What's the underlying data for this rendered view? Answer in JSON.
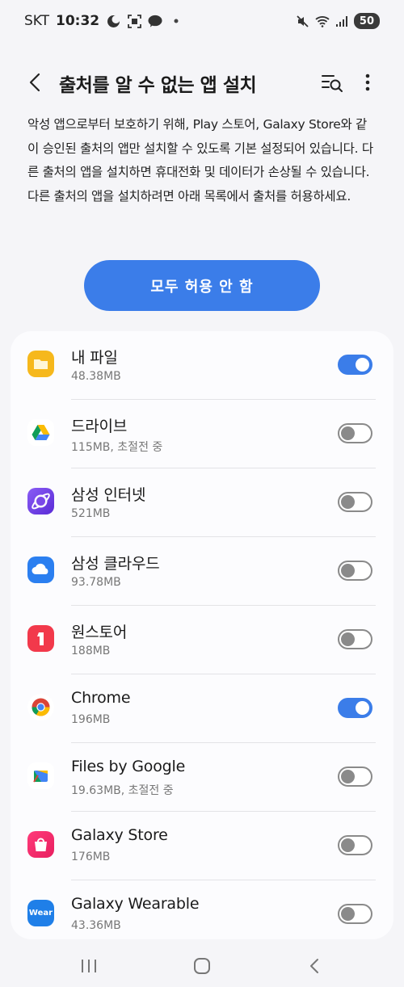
{
  "status": {
    "carrier": "SKT",
    "time": "10:32",
    "battery": "50"
  },
  "header": {
    "title": "출처를 알 수 없는 앱 설치"
  },
  "description": "악성 앱으로부터 보호하기 위해, Play 스토어, Galaxy Store와 같이 승인된 출처의 앱만 설치할 수 있도록 기본 설정되어 있습니다. 다른 출처의 앱을 설치하면 휴대전화 및 데이터가 손상될 수 있습니다. 다른 출처의 앱을 설치하려면 아래 목록에서 출처를 허용하세요.",
  "primary_button": "모두 허용 안 함",
  "colors": {
    "accent": "#3b7de9",
    "toggle_off": "#8a8a8a"
  },
  "apps": [
    {
      "name": "내 파일",
      "sub": "48.38MB",
      "enabled": true,
      "icon": "my-files-icon"
    },
    {
      "name": "드라이브",
      "sub": "115MB, 초절전 중",
      "enabled": false,
      "icon": "google-drive-icon"
    },
    {
      "name": "삼성 인터넷",
      "sub": "521MB",
      "enabled": false,
      "icon": "samsung-internet-icon"
    },
    {
      "name": "삼성 클라우드",
      "sub": "93.78MB",
      "enabled": false,
      "icon": "samsung-cloud-icon"
    },
    {
      "name": "원스토어",
      "sub": "188MB",
      "enabled": false,
      "icon": "onestore-icon"
    },
    {
      "name": "Chrome",
      "sub": "196MB",
      "enabled": true,
      "icon": "chrome-icon"
    },
    {
      "name": "Files by Google",
      "sub": "19.63MB, 초절전 중",
      "enabled": false,
      "icon": "files-by-google-icon"
    },
    {
      "name": "Galaxy Store",
      "sub": "176MB",
      "enabled": false,
      "icon": "galaxy-store-icon"
    },
    {
      "name": "Galaxy Wearable",
      "sub": "43.36MB",
      "enabled": false,
      "icon": "galaxy-wearable-icon",
      "icon_text": "Wear"
    }
  ]
}
